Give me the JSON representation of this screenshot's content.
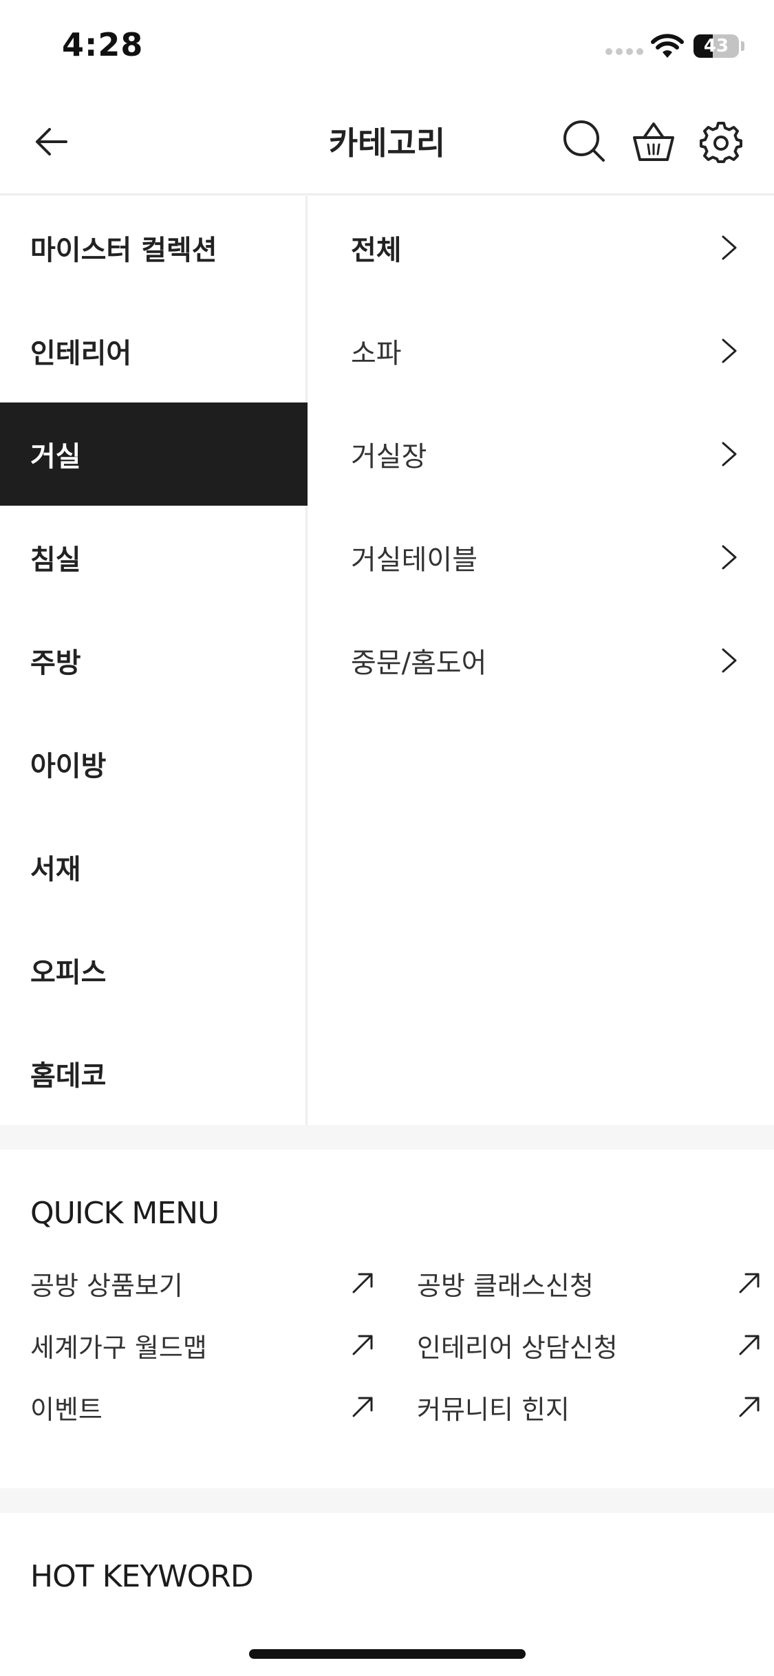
{
  "status_bar": {
    "time": "4:28",
    "battery": "43",
    "battery_level": 0.43
  },
  "header": {
    "title": "카테고리"
  },
  "categories": [
    {
      "label": "마이스터 컬렉션",
      "active": false
    },
    {
      "label": "인테리어",
      "active": false
    },
    {
      "label": "거실",
      "active": true
    },
    {
      "label": "침실",
      "active": false
    },
    {
      "label": "주방",
      "active": false
    },
    {
      "label": "아이방",
      "active": false
    },
    {
      "label": "서재",
      "active": false
    },
    {
      "label": "오피스",
      "active": false
    },
    {
      "label": "홈데코",
      "active": false
    }
  ],
  "subcategories": [
    {
      "label": "전체"
    },
    {
      "label": "소파"
    },
    {
      "label": "거실장"
    },
    {
      "label": "거실테이블"
    },
    {
      "label": "중문/홈도어"
    }
  ],
  "quick_menu": {
    "title": "QUICK MENU",
    "items": [
      {
        "label": "공방 상품보기"
      },
      {
        "label": "공방 클래스신청"
      },
      {
        "label": "세계가구 월드맵"
      },
      {
        "label": "인테리어 상담신청"
      },
      {
        "label": "이벤트"
      },
      {
        "label": "커뮤니티 힌지"
      }
    ]
  },
  "hot_keyword": {
    "title": "HOT KEYWORD"
  },
  "colors": {
    "active_bg": "#1e1e1e",
    "divider": "#eeeeee",
    "band": "#f6f6f6"
  }
}
